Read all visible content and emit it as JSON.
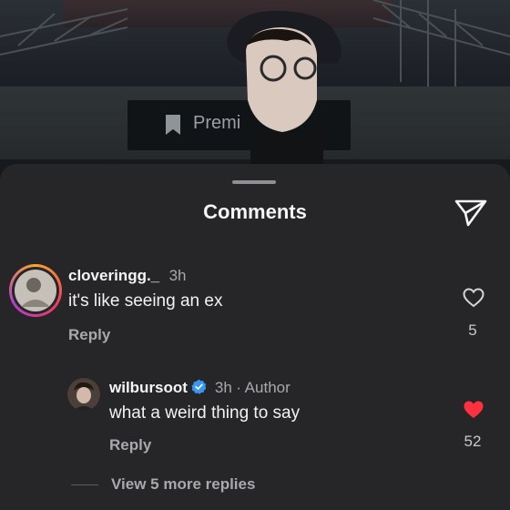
{
  "background": {
    "sign_text": "Premi"
  },
  "sheet": {
    "title": "Comments"
  },
  "comments": [
    {
      "username": "cloveringg._",
      "time": "3h",
      "text": "it's like seeing an ex",
      "reply_label": "Reply",
      "likes": "5",
      "liked": false
    },
    {
      "username": "wilbursoot",
      "verified": true,
      "time": "3h",
      "author_tag": "· Author",
      "text": "what a weird thing to say",
      "reply_label": "Reply",
      "likes": "52",
      "liked": true
    }
  ],
  "view_more": "View 5 more replies",
  "colors": {
    "sheet_bg": "#262628",
    "heart_liked": "#ff3040",
    "verified_badge": "#3897f0"
  }
}
